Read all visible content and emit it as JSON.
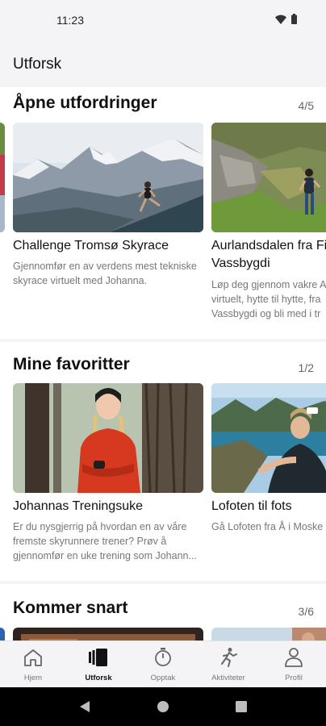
{
  "status_bar": {
    "time": "11:23"
  },
  "app_bar": {
    "title": "Utforsk"
  },
  "sections": [
    {
      "title": "Åpne utfordringer",
      "count": "4/5",
      "cards": [
        {
          "title": "Challenge Tromsø Skyrace",
          "desc": "Gjennomfør en av verdens mest tekniske skyrace virtuelt med Johanna."
        },
        {
          "title": "Aurlandsdalen fra Fin",
          "title2": "Vassbygdi",
          "desc": "Løp deg gjennom vakre A virtuelt, hytte til hytte, fra Vassbygdi og bli med i tr"
        }
      ]
    },
    {
      "title": "Mine favoritter",
      "count": "1/2",
      "cards": [
        {
          "title": "Johannas Treningsuke",
          "desc": "Er du nysgjerrig på hvordan en av våre fremste skyrunnere trener? Prøv å gjennomfør en uke trening som Johann..."
        },
        {
          "title": "Lofoten til fots",
          "desc": "Gå Lofoten fra Å i Moske"
        }
      ]
    },
    {
      "title": "Kommer snart",
      "count": "3/6"
    }
  ],
  "bottom_nav": [
    {
      "label": "Hjem",
      "icon": "home-icon",
      "active": false
    },
    {
      "label": "Utforsk",
      "icon": "explore-cards-icon",
      "active": true
    },
    {
      "label": "Opptak",
      "icon": "stopwatch-icon",
      "active": false
    },
    {
      "label": "Aktiviteter",
      "icon": "runner-icon",
      "active": false
    },
    {
      "label": "Profil",
      "icon": "person-icon",
      "active": false
    }
  ]
}
